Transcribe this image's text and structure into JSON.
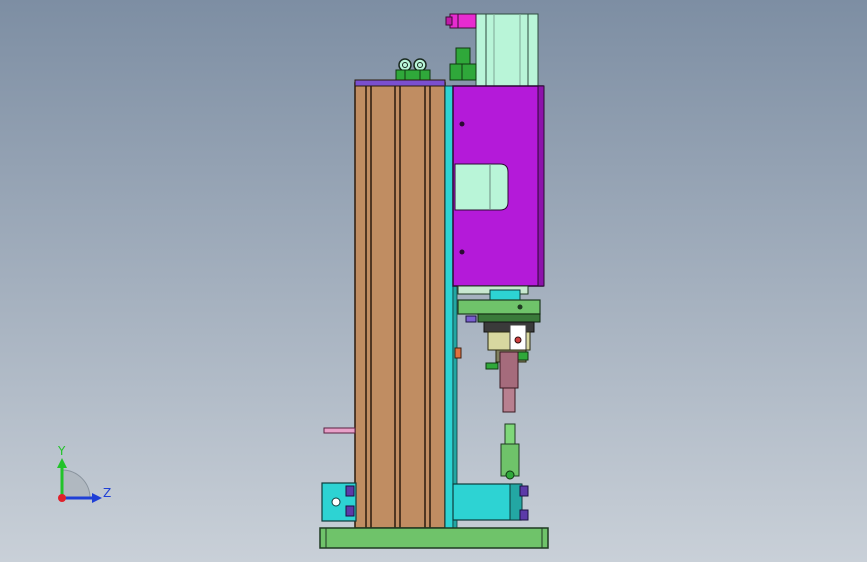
{
  "viewport": {
    "background_top": "#7d8ea3",
    "background_bottom": "#c9d0d8"
  },
  "triad": {
    "y_axis_label": "Y",
    "z_axis_label": "Z",
    "y_color": "#22c32a",
    "z_color": "#1f3fd6",
    "origin_color": "#e0202a"
  },
  "colors": {
    "column_wood": "#c08d62",
    "column_dark": "#7a5230",
    "motor_purple": "#b41ad9",
    "cylinder_mint": "#b9f5d8",
    "cyan": "#2dd3d3",
    "base_green": "#6fc36a",
    "fitting_magenta": "#e82bd0",
    "fitting_green": "#2fa83a",
    "rod_mauve": "#a56b7c",
    "bracket_teal": "#23a7a3"
  }
}
